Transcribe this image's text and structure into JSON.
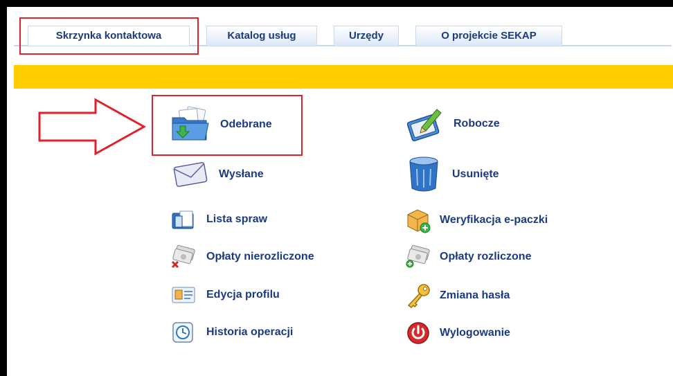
{
  "tabs": [
    {
      "label": "Skrzynka kontaktowa"
    },
    {
      "label": "Katalog usług"
    },
    {
      "label": "Urzędy"
    },
    {
      "label": "O projekcie SEKAP"
    }
  ],
  "menu": {
    "left": [
      {
        "label": "Odebrane",
        "icon": "folder-inbox-icon"
      },
      {
        "label": "Wysłane",
        "icon": "envelope-icon"
      },
      {
        "label": "Lista spraw",
        "icon": "case-list-icon"
      },
      {
        "label": "Opłaty nierozliczone",
        "icon": "unsettled-payments-icon"
      },
      {
        "label": "Edycja profilu",
        "icon": "profile-card-icon"
      },
      {
        "label": "Historia operacji",
        "icon": "clock-history-icon"
      }
    ],
    "right": [
      {
        "label": "Robocze",
        "icon": "draft-pen-icon"
      },
      {
        "label": "Usunięte",
        "icon": "trash-bin-icon"
      },
      {
        "label": "Weryfikacja e-paczki",
        "icon": "package-verify-icon"
      },
      {
        "label": "Opłaty rozliczone",
        "icon": "settled-payments-icon"
      },
      {
        "label": "Zmiana hasła",
        "icon": "key-icon"
      },
      {
        "label": "Wylogowanie",
        "icon": "power-icon"
      }
    ]
  },
  "colors": {
    "band": "#ffcc00",
    "link": "#1a3a84",
    "annotation": "#e3202a"
  }
}
